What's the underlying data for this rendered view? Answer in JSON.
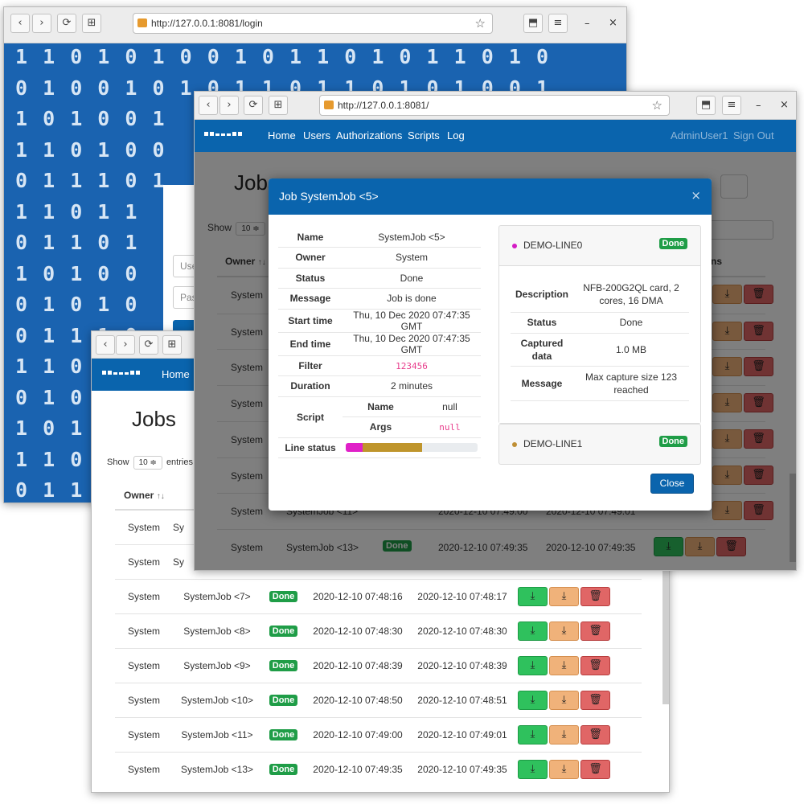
{
  "login_window": {
    "url": "http://127.0.0.1:8081/login",
    "binary_rows": [
      "1 1 0 1 0 1 0 0 1 0 1 1 0 1 0 1 1 0 1 0",
      "0 1 0 0 1 0 1 0 1 1 0 1 1 0 1 0 1 0 0 1",
      "1 0 1 0 0 1",
      "1 1 0 1 0 0",
      "0 1 1 1 0 1",
      "1 1 0 1 1",
      "0 1 1 0 1",
      "1 0 1 0 0",
      "0 1 0 1 0",
      "0 1 1 1 0",
      "1 1 0",
      "0 1 0",
      "1 0 1",
      "1 1 0",
      "0 1 1"
    ],
    "user_placeholder": "Use",
    "pass_placeholder": "Pas"
  },
  "icons": {
    "back": "‹",
    "forward": "›",
    "reload": "⟳",
    "new_tab": "⊞",
    "star": "☆",
    "save": "⬒",
    "menu": "≡",
    "minimize": "–",
    "close": "×",
    "download": "⤓",
    "trash": "🗑",
    "sort": "↑↓"
  },
  "back_window": {
    "url": "http://127.0.0.1:8081/",
    "nav": {
      "home": "Home"
    },
    "title": "Jobs",
    "show_label": "Show",
    "show_value": "10 ≑",
    "entries_label": "entries",
    "columns": {
      "owner": "Owner"
    },
    "rows": [
      {
        "owner": "System",
        "name": "Sy",
        "status": "",
        "start": "",
        "end": ""
      },
      {
        "owner": "System",
        "name": "Sy",
        "status": "",
        "start": "",
        "end": ""
      },
      {
        "owner": "System",
        "name": "SystemJob <7>",
        "status": "Done",
        "start": "2020-12-10 07:48:16",
        "end": "2020-12-10 07:48:17"
      },
      {
        "owner": "System",
        "name": "SystemJob <8>",
        "status": "Done",
        "start": "2020-12-10 07:48:30",
        "end": "2020-12-10 07:48:30"
      },
      {
        "owner": "System",
        "name": "SystemJob <9>",
        "status": "Done",
        "start": "2020-12-10 07:48:39",
        "end": "2020-12-10 07:48:39"
      },
      {
        "owner": "System",
        "name": "SystemJob <10>",
        "status": "Done",
        "start": "2020-12-10 07:48:50",
        "end": "2020-12-10 07:48:51"
      },
      {
        "owner": "System",
        "name": "SystemJob <11>",
        "status": "Done",
        "start": "2020-12-10 07:49:00",
        "end": "2020-12-10 07:49:01"
      },
      {
        "owner": "System",
        "name": "SystemJob <13>",
        "status": "Done",
        "start": "2020-12-10 07:49:35",
        "end": "2020-12-10 07:49:35"
      }
    ]
  },
  "front_window": {
    "url": "http://127.0.0.1:8081/",
    "nav": {
      "home": "Home",
      "users": "Users",
      "authorizations": "Authorizations",
      "scripts": "Scripts",
      "log": "Log",
      "user": "AdminUser1",
      "signout": "Sign Out"
    },
    "title": "Jobs",
    "show_label": "Show",
    "show_value": "10 ≑",
    "columns": {
      "owner": "Owner",
      "actions": "ns"
    },
    "rows": [
      {
        "owner": "System"
      },
      {
        "owner": "System"
      },
      {
        "owner": "System"
      },
      {
        "owner": "System"
      },
      {
        "owner": "System"
      },
      {
        "owner": "System"
      },
      {
        "owner": "System",
        "name": "SystemJob <11>",
        "start": "2020-12-10 07:49:00",
        "end": "2020-12-10 07:49:01"
      },
      {
        "owner": "System",
        "name": "SystemJob <13>",
        "status": "Done",
        "start": "2020-12-10 07:49:35",
        "end": "2020-12-10 07:49:35"
      }
    ],
    "partial_row": {
      "name": "SystemJob <11>",
      "start": "2020-12-10 07:49:00",
      "end": "2020-12-10 07:49:01"
    }
  },
  "modal": {
    "title": "Job SystemJob <5>",
    "close": "×",
    "fields": {
      "name_k": "Name",
      "name_v": "SystemJob <5>",
      "owner_k": "Owner",
      "owner_v": "System",
      "status_k": "Status",
      "status_v": "Done",
      "message_k": "Message",
      "message_v": "Job is done",
      "start_k": "Start time",
      "start_v": "Thu, 10 Dec 2020 07:47:35 GMT",
      "end_k": "End time",
      "end_v": "Thu, 10 Dec 2020 07:47:35 GMT",
      "filter_k": "Filter",
      "filter_v": "123456",
      "duration_k": "Duration",
      "duration_v": "2 minutes",
      "script_k": "Script",
      "script_name_k": "Name",
      "script_name_v": "null",
      "script_args_k": "Args",
      "script_args_v": "null",
      "linestatus_k": "Line status"
    },
    "line_status_bar": [
      {
        "color": "#e020c8",
        "fraction": 0.13
      },
      {
        "color": "#bf952c",
        "fraction": 0.45
      }
    ],
    "line0": {
      "name": "DEMO-LINE0",
      "badge": "Done",
      "dot_color": "#d41bc4",
      "desc_k": "Description",
      "desc_v1": "NFB-200G2QL card, 2",
      "desc_v2": "cores, 16 DMA",
      "status_k": "Status",
      "status_v": "Done",
      "captured_k1": "Captured",
      "captured_k2": "data",
      "captured_v": "1.0 MB",
      "message_k": "Message",
      "message_v1": "Max capture size 123",
      "message_v2": "reached"
    },
    "line1": {
      "name": "DEMO-LINE1",
      "badge": "Done",
      "dot_color": "#bf8f35"
    },
    "close_button": "Close"
  }
}
